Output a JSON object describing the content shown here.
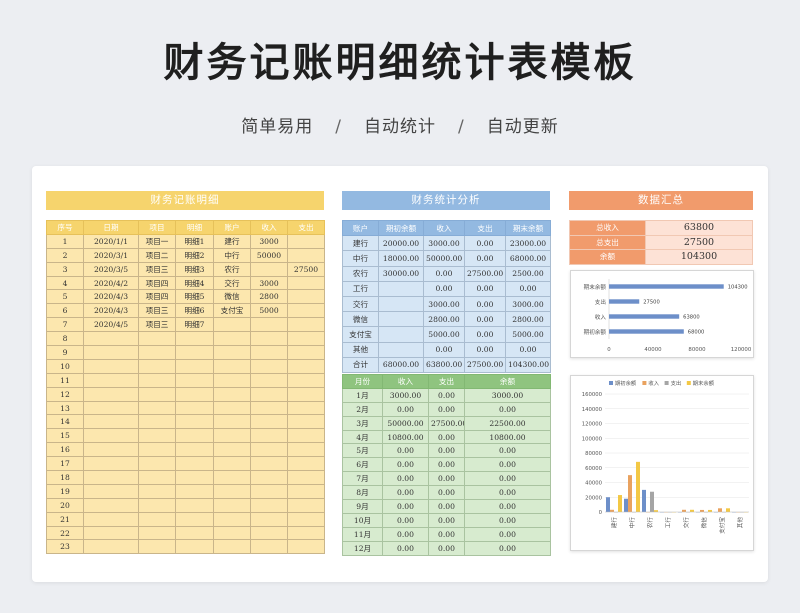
{
  "header": {
    "title": "财务记账明细统计表模板",
    "tagline": [
      "简单易用",
      "自动统计",
      "自动更新"
    ],
    "separator": "/"
  },
  "journal": {
    "title": "财务记账明细",
    "columns": [
      "序号",
      "日期",
      "项目",
      "明细",
      "账户",
      "收入",
      "支出"
    ],
    "rows": [
      [
        "1",
        "2020/1/1",
        "项目一",
        "明细1",
        "建行",
        "3000",
        ""
      ],
      [
        "2",
        "2020/3/1",
        "项目二",
        "明细2",
        "中行",
        "50000",
        ""
      ],
      [
        "3",
        "2020/3/5",
        "项目三",
        "明细3",
        "农行",
        "",
        "27500"
      ],
      [
        "4",
        "2020/4/2",
        "项目四",
        "明细4",
        "交行",
        "3000",
        ""
      ],
      [
        "5",
        "2020/4/3",
        "项目四",
        "明细5",
        "微信",
        "2800",
        ""
      ],
      [
        "6",
        "2020/4/3",
        "项目三",
        "明细6",
        "支付宝",
        "5000",
        ""
      ],
      [
        "7",
        "2020/4/5",
        "项目三",
        "明细7",
        "",
        "",
        ""
      ],
      [
        "8",
        "",
        "",
        "",
        "",
        "",
        ""
      ],
      [
        "9",
        "",
        "",
        "",
        "",
        "",
        ""
      ],
      [
        "10",
        "",
        "",
        "",
        "",
        "",
        ""
      ],
      [
        "11",
        "",
        "",
        "",
        "",
        "",
        ""
      ],
      [
        "12",
        "",
        "",
        "",
        "",
        "",
        ""
      ],
      [
        "13",
        "",
        "",
        "",
        "",
        "",
        ""
      ],
      [
        "14",
        "",
        "",
        "",
        "",
        "",
        ""
      ],
      [
        "15",
        "",
        "",
        "",
        "",
        "",
        ""
      ],
      [
        "16",
        "",
        "",
        "",
        "",
        "",
        ""
      ],
      [
        "17",
        "",
        "",
        "",
        "",
        "",
        ""
      ],
      [
        "18",
        "",
        "",
        "",
        "",
        "",
        ""
      ],
      [
        "19",
        "",
        "",
        "",
        "",
        "",
        ""
      ],
      [
        "20",
        "",
        "",
        "",
        "",
        "",
        ""
      ],
      [
        "21",
        "",
        "",
        "",
        "",
        "",
        ""
      ],
      [
        "22",
        "",
        "",
        "",
        "",
        "",
        ""
      ],
      [
        "23",
        "",
        "",
        "",
        "",
        "",
        ""
      ]
    ]
  },
  "stats": {
    "title": "财务统计分析",
    "columns": [
      "账户",
      "期初余额",
      "收入",
      "支出",
      "期末余额"
    ],
    "rows": [
      [
        "建行",
        "20000.00",
        "3000.00",
        "0.00",
        "23000.00"
      ],
      [
        "中行",
        "18000.00",
        "50000.00",
        "0.00",
        "68000.00"
      ],
      [
        "农行",
        "30000.00",
        "0.00",
        "27500.00",
        "2500.00"
      ],
      [
        "工行",
        "",
        "0.00",
        "0.00",
        "0.00"
      ],
      [
        "交行",
        "",
        "3000.00",
        "0.00",
        "3000.00"
      ],
      [
        "微信",
        "",
        "2800.00",
        "0.00",
        "2800.00"
      ],
      [
        "支付宝",
        "",
        "5000.00",
        "0.00",
        "5000.00"
      ],
      [
        "其他",
        "",
        "0.00",
        "0.00",
        "0.00"
      ],
      [
        "合计",
        "68000.00",
        "63800.00",
        "27500.00",
        "104300.00"
      ]
    ]
  },
  "monthly": {
    "columns": [
      "月份",
      "收入",
      "支出",
      "余额"
    ],
    "rows": [
      [
        "1月",
        "3000.00",
        "0.00",
        "3000.00"
      ],
      [
        "2月",
        "0.00",
        "0.00",
        "0.00"
      ],
      [
        "3月",
        "50000.00",
        "27500.00",
        "22500.00"
      ],
      [
        "4月",
        "10800.00",
        "0.00",
        "10800.00"
      ],
      [
        "5月",
        "0.00",
        "0.00",
        "0.00"
      ],
      [
        "6月",
        "0.00",
        "0.00",
        "0.00"
      ],
      [
        "7月",
        "0.00",
        "0.00",
        "0.00"
      ],
      [
        "8月",
        "0.00",
        "0.00",
        "0.00"
      ],
      [
        "9月",
        "0.00",
        "0.00",
        "0.00"
      ],
      [
        "10月",
        "0.00",
        "0.00",
        "0.00"
      ],
      [
        "11月",
        "0.00",
        "0.00",
        "0.00"
      ],
      [
        "12月",
        "0.00",
        "0.00",
        "0.00"
      ]
    ]
  },
  "summary": {
    "title": "数据汇总",
    "rows": [
      {
        "label": "总收入",
        "value": "63800"
      },
      {
        "label": "总支出",
        "value": "27500"
      },
      {
        "label": "余额",
        "value": "104300"
      }
    ]
  },
  "colors": {
    "journal": "#f6d46d",
    "stats": "#93b9e1",
    "monthly": "#8fc47f",
    "summary": "#f19b6c",
    "bar_blue": "#6d8fc9",
    "bar_orange": "#e9a25f",
    "bar_gray": "#a5a5a5",
    "bar_yellow": "#f3c845"
  },
  "chart_data": [
    {
      "type": "bar",
      "orientation": "horizontal",
      "categories": [
        "期末余额",
        "支出",
        "收入",
        "期初余额"
      ],
      "values": [
        104300,
        27500,
        63800,
        68000
      ],
      "data_labels": [
        "104300",
        "27500",
        "63800",
        "68000"
      ],
      "xlim": [
        0,
        120000
      ],
      "xticks": [
        "0",
        "40000",
        "80000",
        "120000"
      ],
      "grid": false
    },
    {
      "type": "bar",
      "categories": [
        "建行",
        "中行",
        "农行",
        "工行",
        "交行",
        "微信",
        "支付宝",
        "其他"
      ],
      "series": [
        {
          "name": "期初余额",
          "values": [
            20000,
            18000,
            30000,
            0,
            0,
            0,
            0,
            0
          ]
        },
        {
          "name": "收入",
          "values": [
            3000,
            50000,
            0,
            0,
            3000,
            2800,
            5000,
            0
          ]
        },
        {
          "name": "支出",
          "values": [
            0,
            0,
            27500,
            0,
            0,
            0,
            0,
            0
          ]
        },
        {
          "name": "期末余额",
          "values": [
            23000,
            68000,
            2500,
            0,
            3000,
            2800,
            5000,
            0
          ]
        }
      ],
      "ylim": [
        0,
        160000
      ],
      "yticks": [
        "0",
        "20000",
        "40000",
        "60000",
        "80000",
        "100000",
        "120000",
        "140000",
        "160000"
      ],
      "legend": "top",
      "grid": true
    }
  ]
}
